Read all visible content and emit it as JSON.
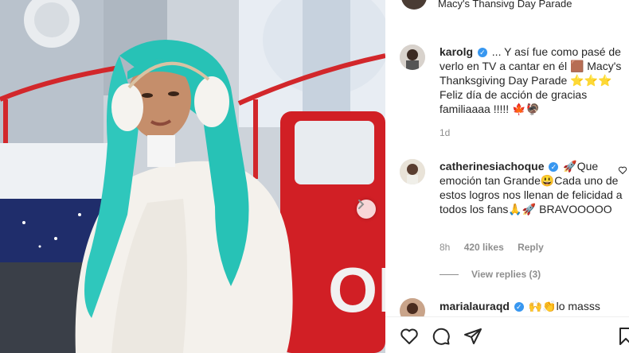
{
  "post": {
    "photo_alt": "",
    "next_icon": "chevron-right-icon"
  },
  "caption_header": {
    "text": "Macy's Thansivg Day Parade"
  },
  "comments": [
    {
      "username": "karolg",
      "verified": true,
      "text": "... Y así fue como pasé de verlo en TV a cantar en él 🟫 Macy's Thanksgiving Day Parade ⭐⭐⭐ Feliz día de acción de gracias familiaaaa !!!!! 🍁🦃",
      "time": "1d"
    },
    {
      "username": "catherinesiachoque",
      "verified": true,
      "text": "🚀Que emoción tan Grande😃Cada uno de estos logros nos llenan de felicidad a todos los fans🙏🚀 BRAVOOOOO",
      "time": "8h",
      "likes": "420 likes",
      "reply": "Reply",
      "view_replies": "View replies (3)"
    },
    {
      "username": "marialauraqd",
      "verified": true,
      "text": "🙌👏lo masss"
    }
  ],
  "actions": {
    "like_icon": "heart-icon",
    "comment_icon": "comment-icon",
    "share_icon": "paper-plane-icon",
    "save_icon": "bookmark-icon"
  }
}
